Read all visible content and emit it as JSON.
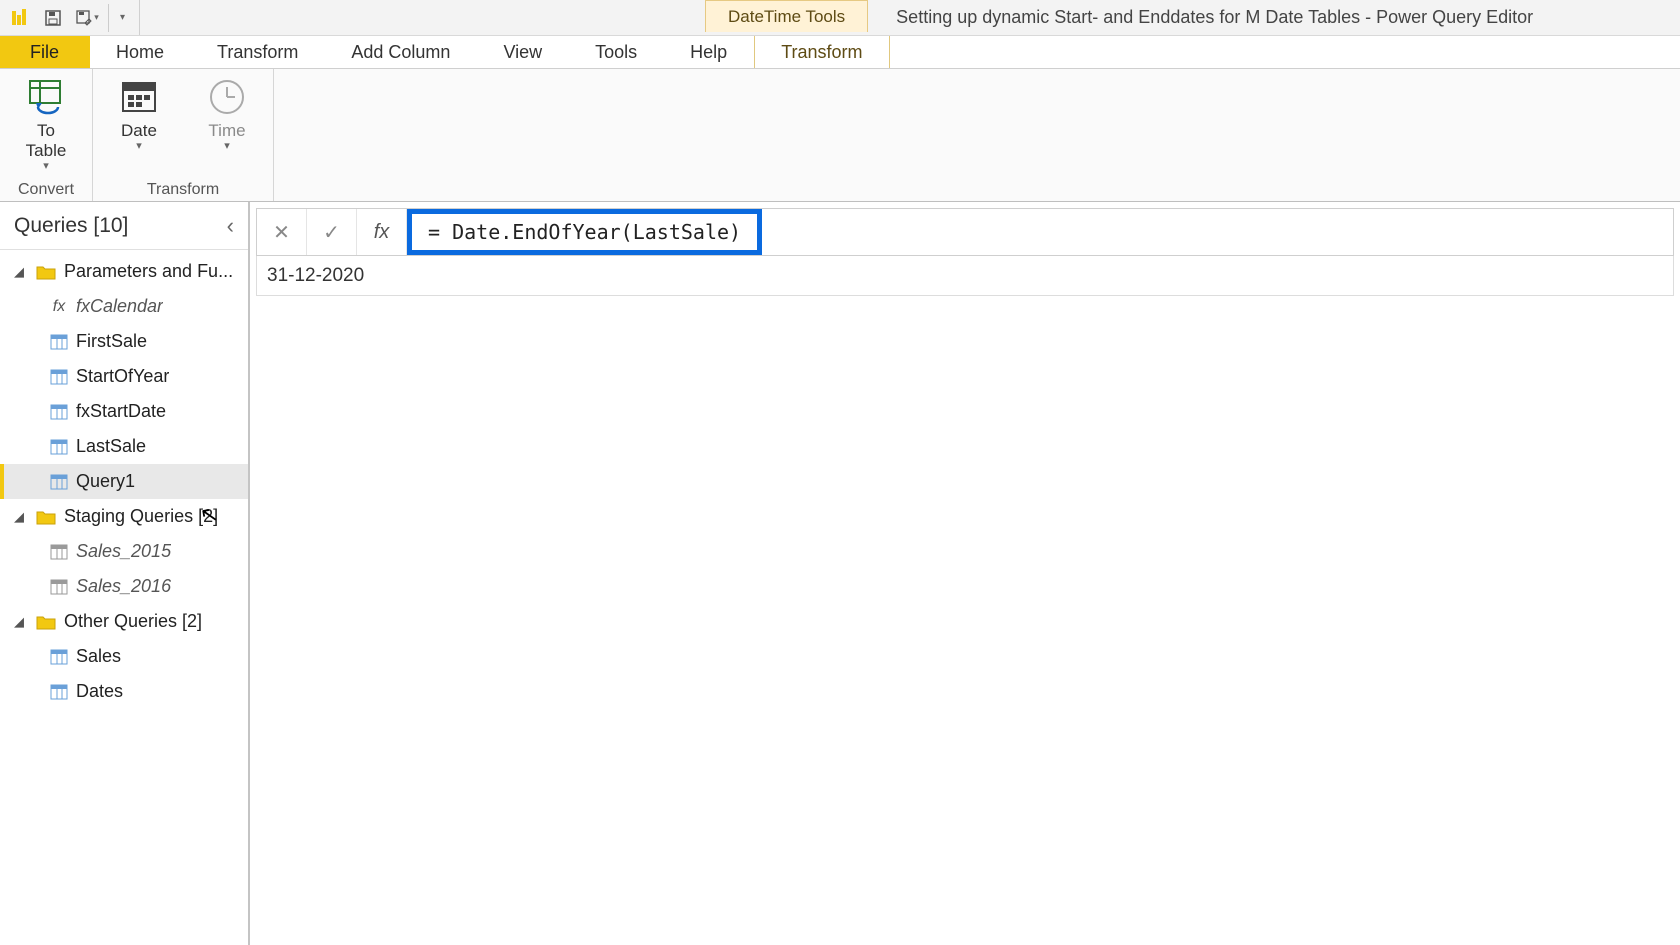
{
  "titlebar": {
    "context_tab": "DateTime Tools",
    "document_title": "Setting up dynamic Start- and Enddates for M Date Tables - Power Query Editor"
  },
  "ribbon_tabs": {
    "file": "File",
    "home": "Home",
    "transform1": "Transform",
    "add_column": "Add Column",
    "view": "View",
    "tools": "Tools",
    "help": "Help",
    "transform_ctx": "Transform"
  },
  "ribbon": {
    "to_table": "To\nTable",
    "date": "Date",
    "time": "Time",
    "group_convert": "Convert",
    "group_transform": "Transform"
  },
  "sidebar": {
    "header": "Queries [10]",
    "folders": {
      "params": "Parameters and Fu...",
      "staging": "Staging Queries [2]",
      "other": "Other Queries [2]"
    },
    "items": {
      "fxCalendar": "fxCalendar",
      "firstSale": "FirstSale",
      "startOfYear": "StartOfYear",
      "fxStartDate": "fxStartDate",
      "lastSale": "LastSale",
      "query1": "Query1",
      "sales2015": "Sales_2015",
      "sales2016": "Sales_2016",
      "sales": "Sales",
      "dates": "Dates"
    }
  },
  "formula_bar": {
    "formula": "= Date.EndOfYear(LastSale)",
    "result": "31-12-2020"
  }
}
